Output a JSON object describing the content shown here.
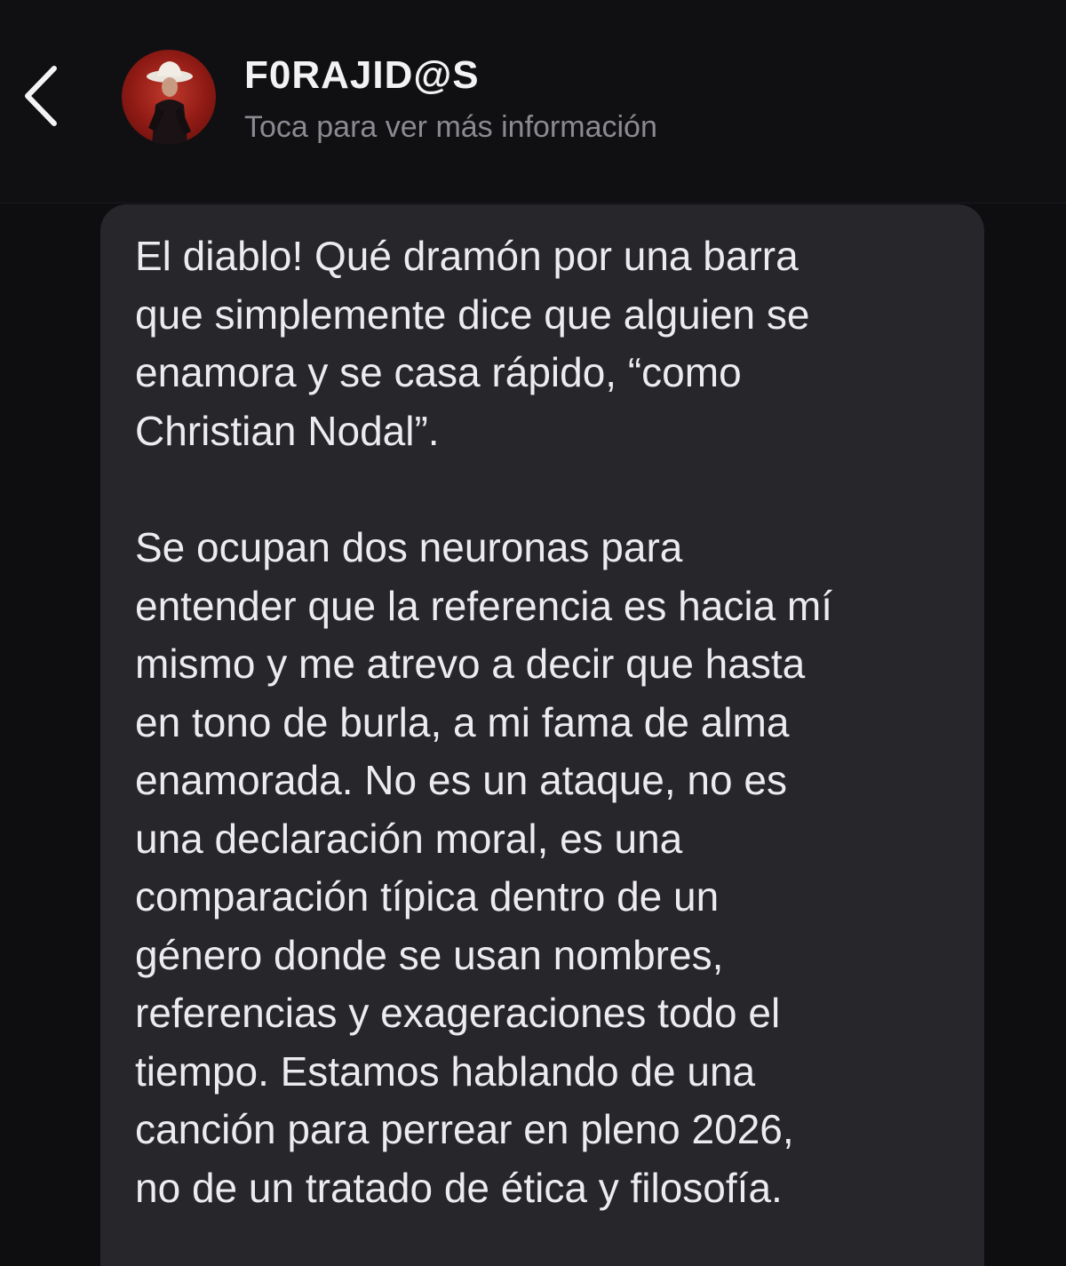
{
  "header": {
    "contact_name": "F0RAJID@S",
    "subtitle": "Toca para ver más información",
    "back_icon": "chevron-left-icon",
    "avatar_icon": "contact-avatar"
  },
  "message": {
    "paragraphs": [
      {
        "lines": [
          "El diablo! Qué dramón por una barra",
          "que simplemente dice que alguien se",
          "enamora y se casa rápido, “como",
          "Christian Nodal”."
        ]
      },
      {
        "lines": [
          "Se ocupan dos neuronas para",
          "entender que la referencia es hacia mí",
          "mismo y me atrevo a decir que hasta",
          "en tono de burla, a mi fama de alma",
          "enamorada. No es un ataque, no es",
          "una declaración moral, es una",
          "comparación típica dentro de un",
          "género donde se usan nombres,",
          "referencias y exageraciones todo el",
          "tiempo. Estamos hablando de una",
          "canción para perrear en pleno 2026,",
          "no de un tratado de ética y filosofía."
        ]
      }
    ]
  },
  "colors": {
    "background": "#0e0e11",
    "bubble": "#26262b",
    "text": "#ececef",
    "subtitle": "#8a8a90"
  }
}
